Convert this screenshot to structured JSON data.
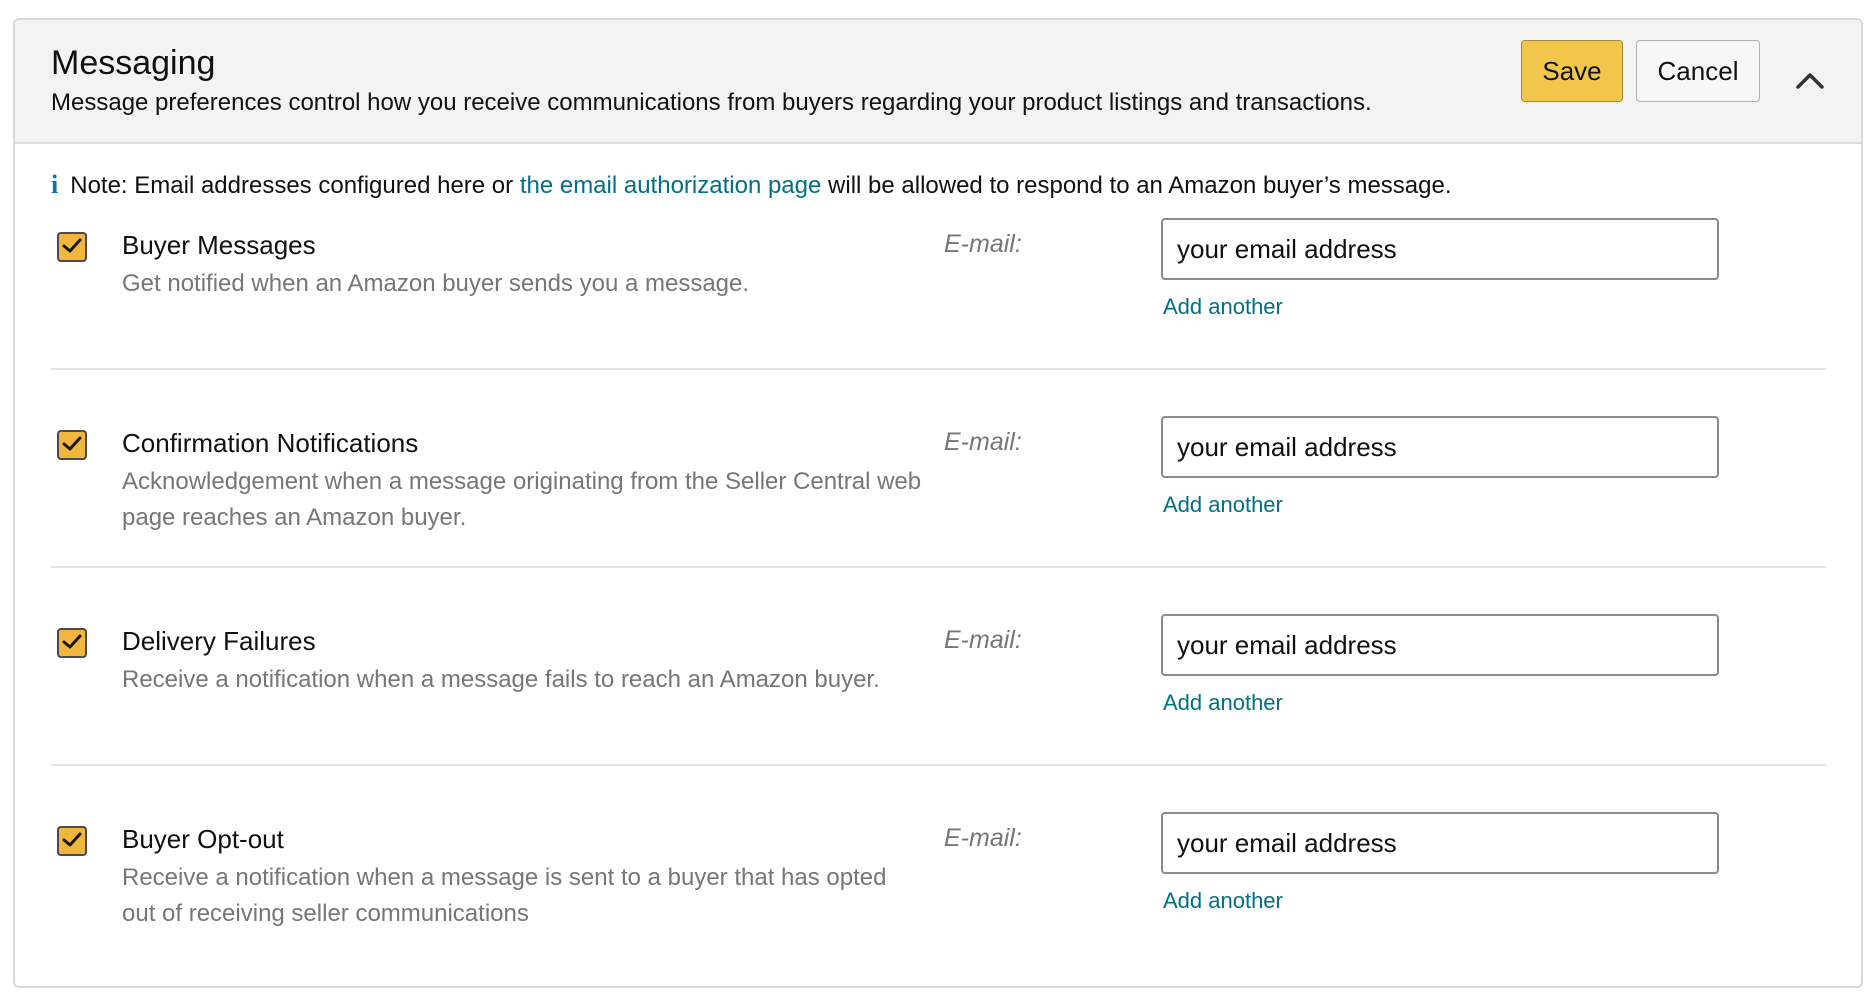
{
  "header": {
    "title": "Messaging",
    "subtitle": "Message preferences control how you receive communications from buyers regarding your product listings and transactions.",
    "save_label": "Save",
    "cancel_label": "Cancel"
  },
  "note": {
    "icon": "i",
    "prefix": "Note: Email addresses configured here or ",
    "link_text": "the email authorization page",
    "suffix": " will be allowed to respond to an Amazon buyer’s message."
  },
  "colors": {
    "accent_checkbox": "#f0b63e",
    "save_button": "#f2c64b",
    "link": "#007185"
  },
  "rows": [
    {
      "title": "Buyer Messages",
      "description": "Get notified when an Amazon buyer sends you a message.",
      "checked": true,
      "email_label": "E-mail:",
      "email_placeholder": "your email address",
      "add_link": "Add another"
    },
    {
      "title": "Confirmation Notifications",
      "description": "Acknowledgement when a message originating from the Seller Central web page reaches an Amazon buyer.",
      "checked": true,
      "email_label": "E-mail:",
      "email_placeholder": "your email address",
      "add_link": "Add another"
    },
    {
      "title": "Delivery Failures",
      "description": "Receive a notification when a message fails to reach an Amazon buyer.",
      "checked": true,
      "email_label": "E-mail:",
      "email_placeholder": "your email address",
      "add_link": "Add another"
    },
    {
      "title": "Buyer Opt-out",
      "description": "Receive a notification when a message is sent to a buyer that has opted out of receiving seller communications",
      "checked": true,
      "email_label": "E-mail:",
      "email_placeholder": "your email address",
      "add_link": "Add another"
    }
  ]
}
